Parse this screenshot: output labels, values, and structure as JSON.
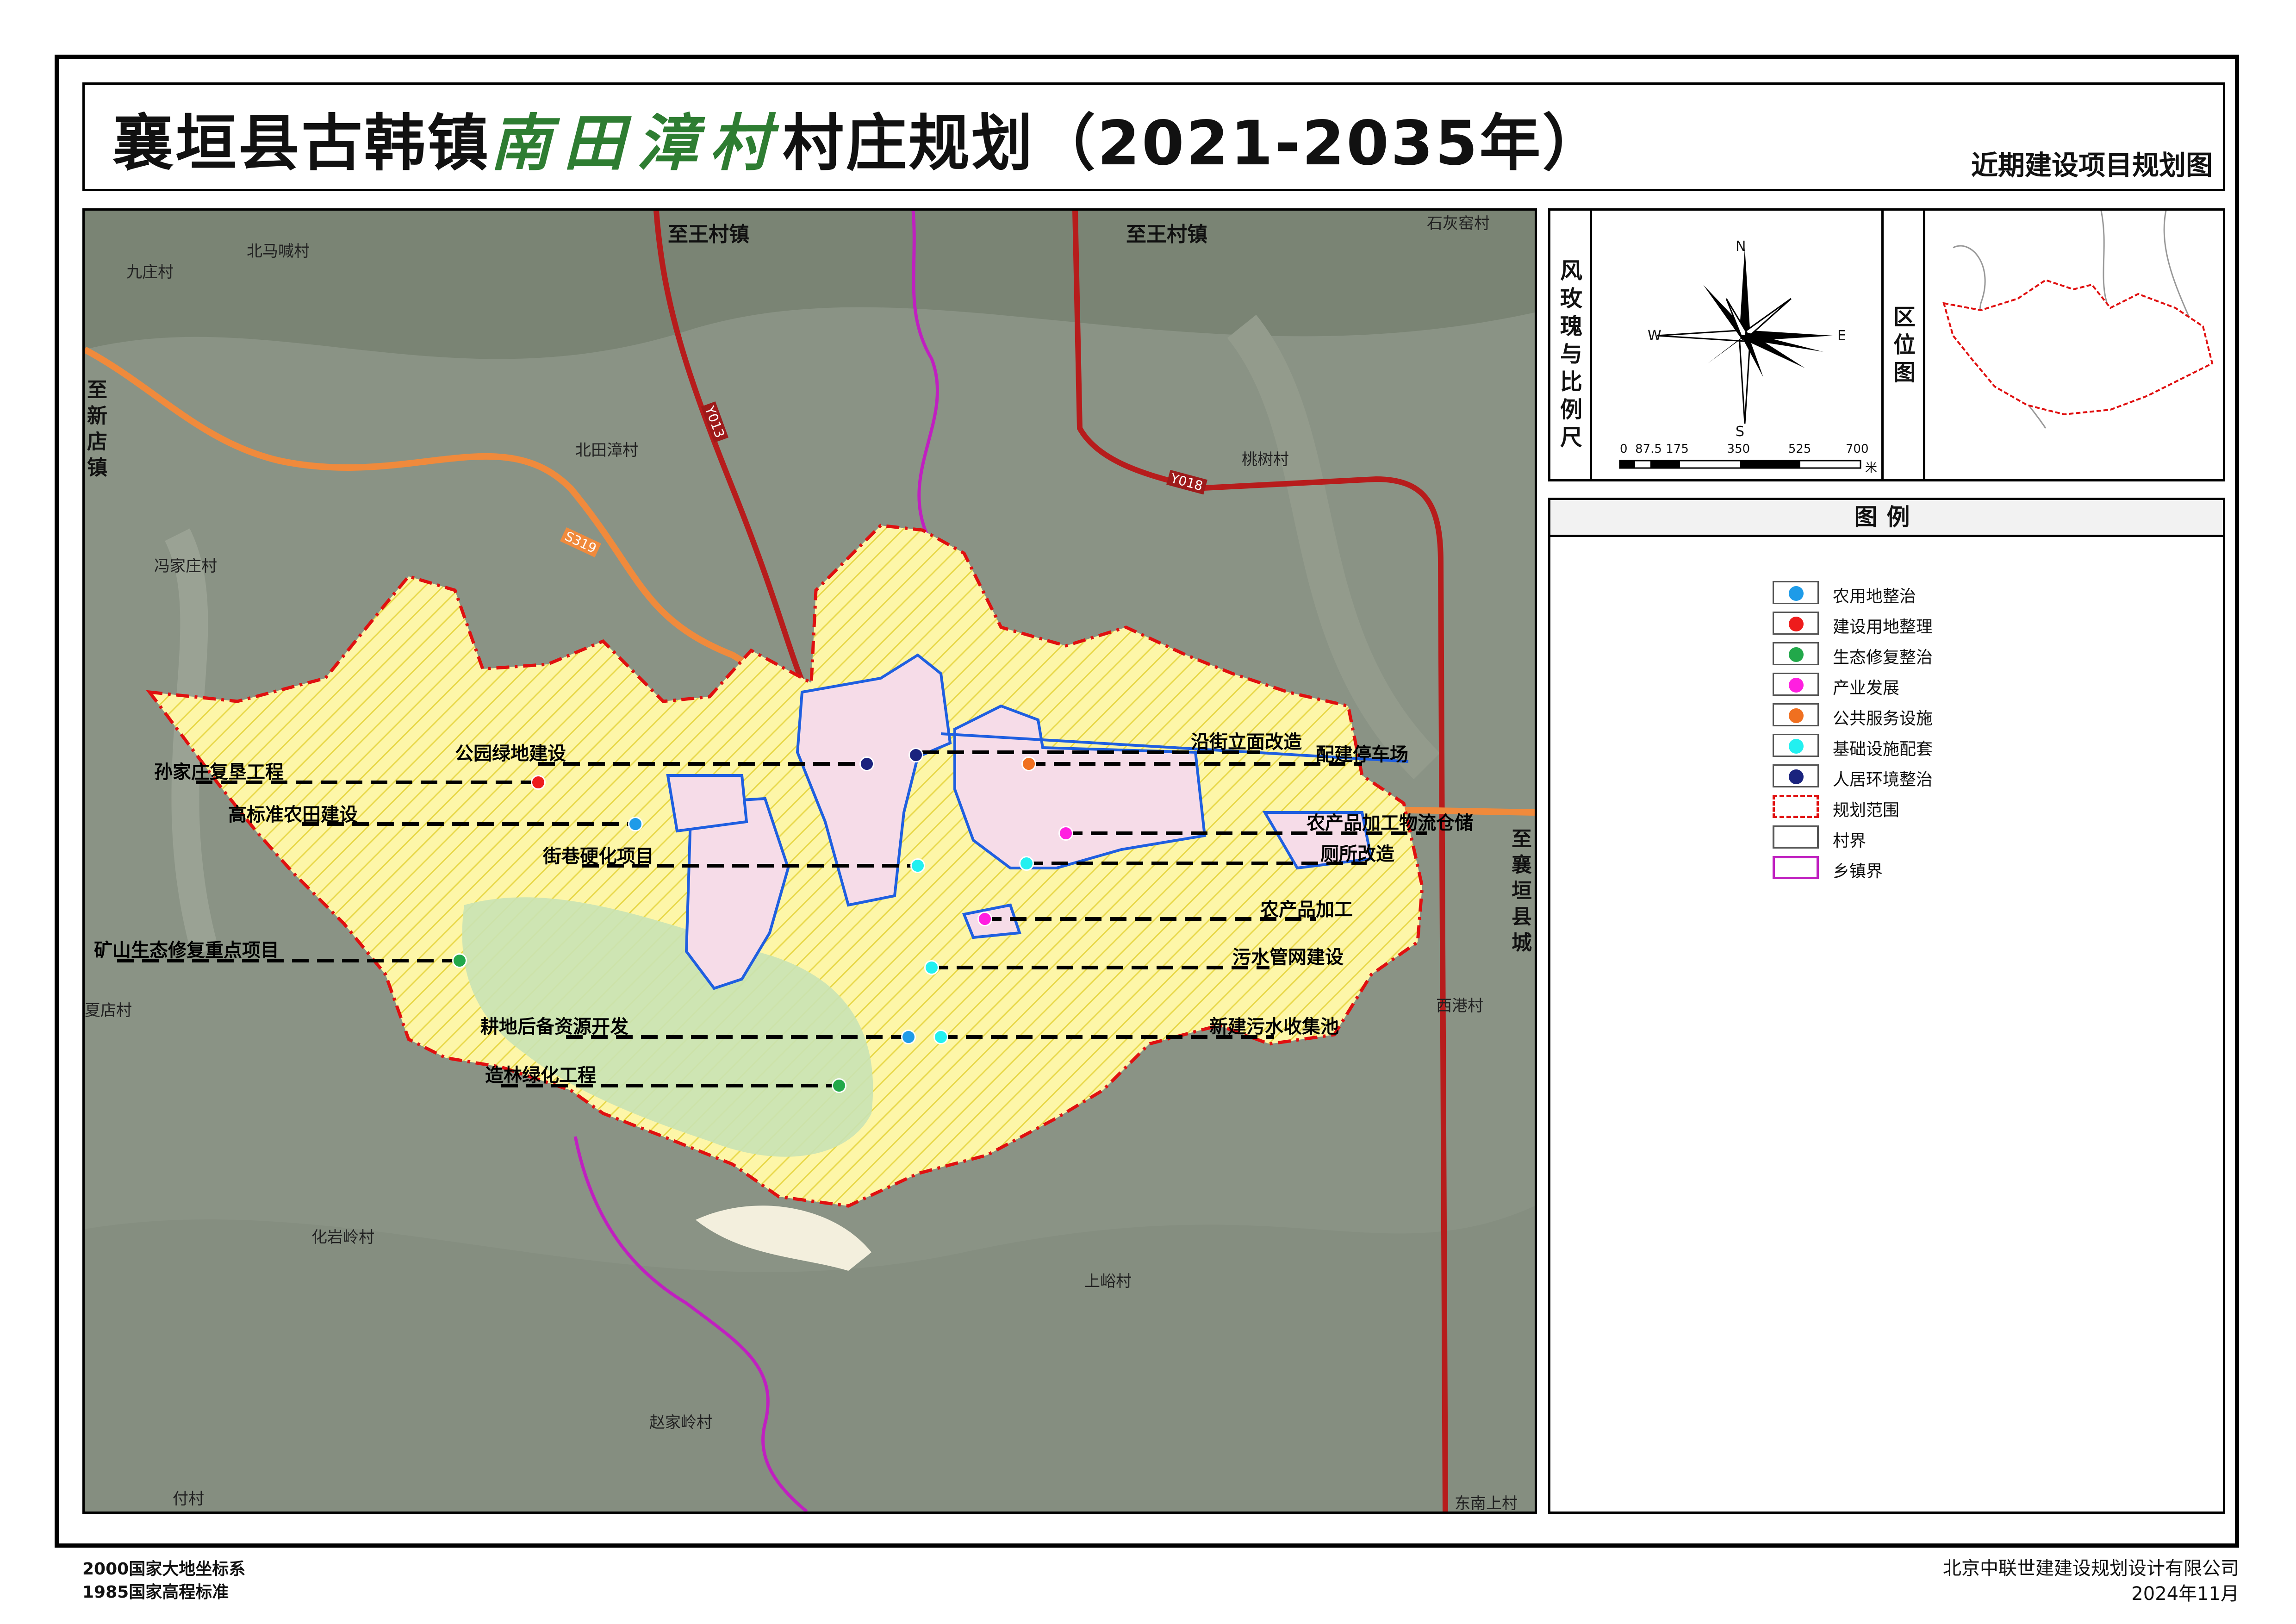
{
  "title": {
    "prefix": "襄垣县古韩镇",
    "village": "南田漳村",
    "suffix": "村庄规划（2021-2035年）",
    "subtitle": "近期建设项目规划图"
  },
  "map": {
    "place_labels": [
      {
        "id": "beimahan",
        "text": "北马喊村"
      },
      {
        "id": "jiuzhuang",
        "text": "九庄村"
      },
      {
        "id": "beitianzhang",
        "text": "北田漳村"
      },
      {
        "id": "fengjiazhuang",
        "text": "冯家庄村"
      },
      {
        "id": "taoshu",
        "text": "桃树村"
      },
      {
        "id": "xiagang",
        "text": "西港村"
      },
      {
        "id": "xiadian",
        "text": "夏店村"
      },
      {
        "id": "huayanling",
        "text": "化岩岭村"
      },
      {
        "id": "shangyu",
        "text": "上峪村"
      },
      {
        "id": "zhaojialing",
        "text": "赵家岭村"
      },
      {
        "id": "fucheng",
        "text": "付村"
      },
      {
        "id": "dongnanshang",
        "text": "东南上村"
      },
      {
        "id": "shihuiyao",
        "text": "石灰窑村"
      }
    ],
    "direction_labels": {
      "to_wangcun_1": "至王村镇",
      "to_wangcun_2": "至王村镇",
      "to_xindian": "至新店镇",
      "to_xiangyuan": "至襄垣县城"
    },
    "road_tags": [
      "Y013",
      "Y018",
      "S319"
    ],
    "annotations": [
      {
        "id": "sunjiazhuang",
        "text": "孙家庄复垦工程",
        "category": "建设用地整理"
      },
      {
        "id": "park",
        "text": "公园绿地建设",
        "category": "建设用地整理"
      },
      {
        "id": "farmland",
        "text": "高标准农田建设",
        "category": "农用地整治"
      },
      {
        "id": "street",
        "text": "街巷硬化项目",
        "category": "基础设施配套"
      },
      {
        "id": "facade",
        "text": "沿街立面改造",
        "category": "人居环境整治"
      },
      {
        "id": "parking",
        "text": "配建停车场",
        "category": "公共服务设施"
      },
      {
        "id": "logistics",
        "text": "农产品加工物流仓储",
        "category": "产业发展"
      },
      {
        "id": "toilet",
        "text": "厕所改造",
        "category": "基础设施配套"
      },
      {
        "id": "processing",
        "text": "农产品加工",
        "category": "产业发展"
      },
      {
        "id": "mine",
        "text": "矿山生态修复重点项目",
        "category": "生态修复整治"
      },
      {
        "id": "sewage_net",
        "text": "污水管网建设",
        "category": "基础设施配套"
      },
      {
        "id": "reserve",
        "text": "耕地后备资源开发",
        "category": "农用地整治"
      },
      {
        "id": "sewage_pool",
        "text": "新建污水收集池",
        "category": "基础设施配套"
      },
      {
        "id": "forest",
        "text": "造林绿化工程",
        "category": "生态修复整治"
      }
    ]
  },
  "inset": {
    "windrose_label": "风玫瑰与比例尺",
    "compass": {
      "n": "N",
      "s": "S",
      "e": "E",
      "w": "W"
    },
    "scale_ticks": [
      "0",
      "87.5",
      "175",
      "350",
      "525",
      "700"
    ],
    "scale_unit": "米",
    "location_label": "区位图"
  },
  "legend": {
    "title": "图例",
    "items": [
      {
        "label": "农用地整治",
        "type": "dot",
        "color": "#1e9be8"
      },
      {
        "label": "建设用地整理",
        "type": "dot",
        "color": "#ee1c1c"
      },
      {
        "label": "生态修复整治",
        "type": "dot",
        "color": "#22a84a"
      },
      {
        "label": "产业发展",
        "type": "dot",
        "color": "#ff1fe0"
      },
      {
        "label": "公共服务设施",
        "type": "dot",
        "color": "#f07020"
      },
      {
        "label": "基础设施配套",
        "type": "dot",
        "color": "#22f0f0"
      },
      {
        "label": "人居环境整治",
        "type": "dot",
        "color": "#1a237e"
      },
      {
        "label": "规划范围",
        "type": "dash",
        "color": "#e01010"
      },
      {
        "label": "村界",
        "type": "box",
        "color": "#555555"
      },
      {
        "label": "乡镇界",
        "type": "box",
        "color": "#c020c0"
      }
    ]
  },
  "footer": {
    "coord1": "2000国家大地坐标系",
    "coord2": "1985国家高程标准",
    "company": "北京中联世建建设规划设计有限公司",
    "date": "2024年11月"
  }
}
